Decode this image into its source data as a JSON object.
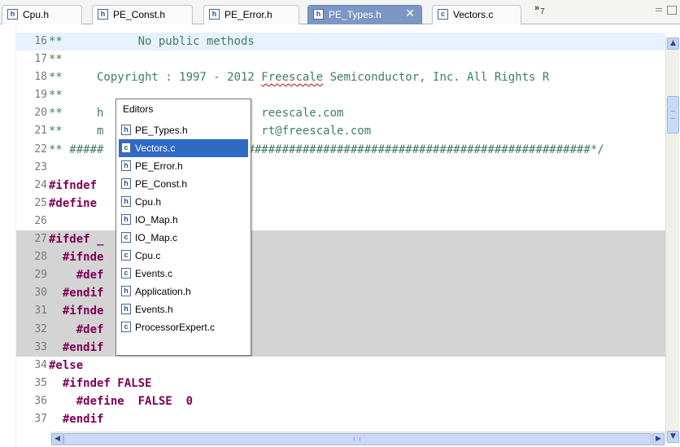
{
  "tabs": [
    {
      "label": "Cpu.h",
      "icon": "h-file-icon",
      "icon_glyph": "h"
    },
    {
      "label": "PE_Const.h",
      "icon": "h-file-icon",
      "icon_glyph": "h"
    },
    {
      "label": "PE_Error.h",
      "icon": "h-file-icon",
      "icon_glyph": "h"
    },
    {
      "label": "PE_Types.h",
      "icon": "h-file-icon",
      "icon_glyph": "h",
      "active": true,
      "close_glyph": "✕"
    },
    {
      "label": "Vectors.c",
      "icon": "c-file-icon",
      "icon_glyph": "c"
    }
  ],
  "overflow": {
    "glyph": "»",
    "count": "7"
  },
  "editor": {
    "lines": [
      {
        "n": "16",
        "text": "**           No public methods"
      },
      {
        "n": "17",
        "text": "**"
      },
      {
        "n": "18",
        "text": "**     Copyright : 1997 - 2012 Freescale Semiconductor, Inc. All Rights R"
      },
      {
        "n": "19",
        "text": "**"
      },
      {
        "n": "20",
        "text": "**     h                       reescale.com"
      },
      {
        "n": "21",
        "text": "**     m                       rt@freescale.com"
      },
      {
        "n": "22",
        "text": "** #####                     ##################################################*/"
      },
      {
        "n": "23",
        "text": ""
      },
      {
        "n": "24",
        "text": "#ifndef"
      },
      {
        "n": "25",
        "text": "#define"
      },
      {
        "n": "26",
        "text": ""
      },
      {
        "n": "27",
        "text": "#ifdef _"
      },
      {
        "n": "28",
        "text": "  #ifnde"
      },
      {
        "n": "29",
        "text": "    #def"
      },
      {
        "n": "30",
        "text": "  #endif"
      },
      {
        "n": "31",
        "text": "  #ifnde"
      },
      {
        "n": "32",
        "text": "    #def"
      },
      {
        "n": "33",
        "text": "  #endif"
      },
      {
        "n": "34",
        "text": "#else"
      },
      {
        "n": "35",
        "text": "  #ifndef FALSE"
      },
      {
        "n": "36",
        "text": "    #define  FALSE  0"
      },
      {
        "n": "37",
        "text": "  #endif"
      }
    ]
  },
  "popup": {
    "title": "Editors",
    "items": [
      {
        "label": "PE_Types.h",
        "glyph": "h"
      },
      {
        "label": "Vectors.c",
        "glyph": "c",
        "selected": true
      },
      {
        "label": "PE_Error.h",
        "glyph": "h"
      },
      {
        "label": "PE_Const.h",
        "glyph": "h"
      },
      {
        "label": "Cpu.h",
        "glyph": "h"
      },
      {
        "label": "IO_Map.h",
        "glyph": "h"
      },
      {
        "label": "IO_Map.c",
        "glyph": "c"
      },
      {
        "label": "Cpu.c",
        "glyph": "c"
      },
      {
        "label": "Events.c",
        "glyph": "c"
      },
      {
        "label": "Application.h",
        "glyph": "h"
      },
      {
        "label": "Events.h",
        "glyph": "h"
      },
      {
        "label": "ProcessorExpert.c",
        "glyph": "c"
      }
    ]
  },
  "scrollbars": {
    "up": "▲",
    "down": "▼",
    "left": "◀",
    "right": "▶"
  },
  "colors": {
    "keyword": "#7f0055",
    "comment": "#3f7f5f",
    "selection": "#316ac5",
    "active_tab": "#7d97c5",
    "current_line": "#e8f2fe",
    "inactive_block": "#d4d4d4"
  }
}
